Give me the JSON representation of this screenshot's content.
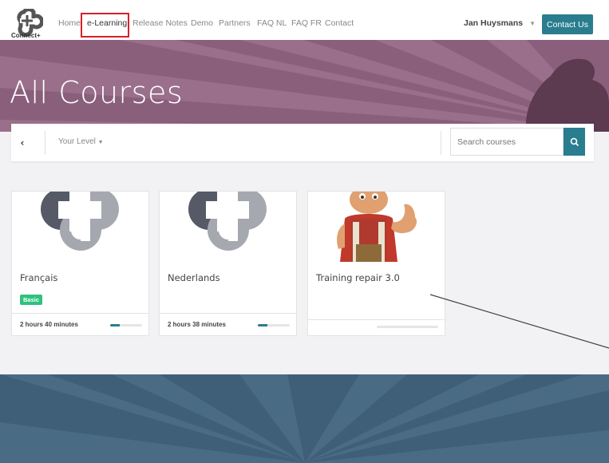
{
  "brand": {
    "logo_text": "Connect+"
  },
  "nav": {
    "items": [
      "Home",
      "e-Learning",
      "Release Notes",
      "Demo",
      "Partners",
      "FAQ NL",
      "FAQ FR",
      "Contact"
    ],
    "active": "e-Learning"
  },
  "user": {
    "name": "Jan Huysmans"
  },
  "header": {
    "contact_label": "Contact Us"
  },
  "hero": {
    "title": "All Courses"
  },
  "filter": {
    "level_label": "Your Level",
    "search_placeholder": "Search courses"
  },
  "courses": [
    {
      "title": "Français",
      "badge": "Basic",
      "duration": "2 hours 40 minutes",
      "progress": 0.3
    },
    {
      "title": "Nederlands",
      "badge": "",
      "duration": "2 hours 38 minutes",
      "progress": 0.3
    },
    {
      "title": "Training repair 3.0",
      "badge": "",
      "duration": "",
      "progress": 0
    }
  ],
  "colors": {
    "accent": "#2a7d8f",
    "hero": "#8a5f7b",
    "footer": "#3f5f78",
    "badge": "#2ec27e",
    "highlight": "#d6202a"
  }
}
